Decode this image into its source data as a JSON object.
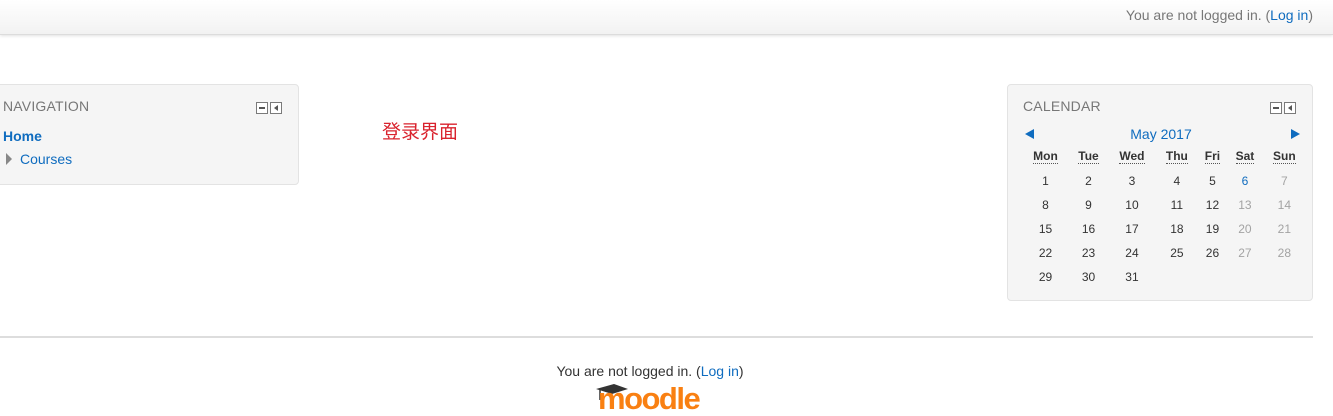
{
  "header": {
    "not_logged_in": "You are not logged in. (",
    "login_link": "Log in",
    "close_paren": ")"
  },
  "navigation": {
    "title": "NAVIGATION",
    "home": "Home",
    "courses": "Courses"
  },
  "main": {
    "text": "登录界面"
  },
  "calendar": {
    "title": "CALENDAR",
    "month_label": "May 2017",
    "weekdays": [
      "Mon",
      "Tue",
      "Wed",
      "Thu",
      "Fri",
      "Sat",
      "Sun"
    ],
    "weeks": [
      [
        "1",
        "2",
        "3",
        "4",
        "5",
        "6",
        "7"
      ],
      [
        "8",
        "9",
        "10",
        "11",
        "12",
        "13",
        "14"
      ],
      [
        "15",
        "16",
        "17",
        "18",
        "19",
        "20",
        "21"
      ],
      [
        "22",
        "23",
        "24",
        "25",
        "26",
        "27",
        "28"
      ],
      [
        "29",
        "30",
        "31",
        "",
        "",
        "",
        ""
      ]
    ],
    "today": "6"
  },
  "footer": {
    "not_logged_in": "You are not logged in. (",
    "login_link": "Log in",
    "close_paren": ")",
    "logo_alt": "moodle"
  },
  "colors": {
    "link": "#0f6cbf",
    "main_text": "#d9232e",
    "logo_orange": "#f98012"
  }
}
